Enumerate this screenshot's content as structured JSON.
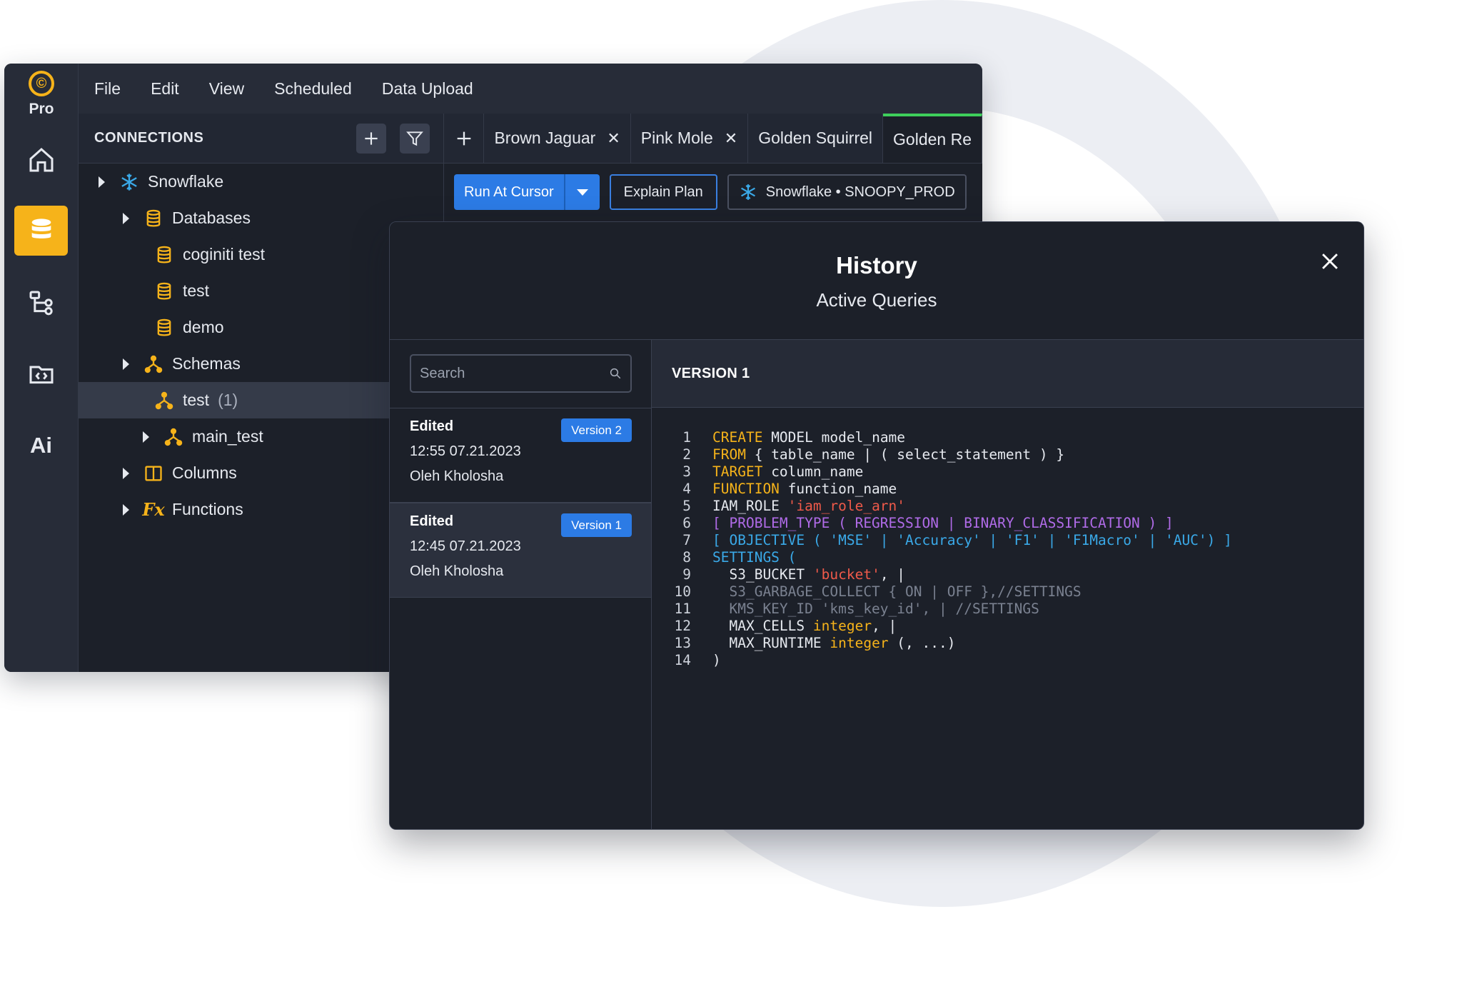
{
  "app": {
    "logo_text": "Pro",
    "rail": {
      "ai_label": "Ai"
    },
    "menu": [
      "File",
      "Edit",
      "View",
      "Scheduled",
      "Data Upload"
    ],
    "connections": {
      "title": "CONNECTIONS",
      "tree": [
        {
          "label": "Snowflake"
        },
        {
          "label": "Databases"
        },
        {
          "label": "coginiti test"
        },
        {
          "label": "test"
        },
        {
          "label": "demo"
        },
        {
          "label": "Schemas"
        },
        {
          "label": "test",
          "count": "(1)"
        },
        {
          "label": "main_test"
        },
        {
          "label": "Columns"
        },
        {
          "label": "Functions",
          "icon_text": "Fx"
        }
      ]
    },
    "tabs": [
      {
        "label": "Brown Jaguar",
        "close": "✕"
      },
      {
        "label": "Pink Mole",
        "close": "✕"
      },
      {
        "label": "Golden Squirrel"
      },
      {
        "label": "Golden Re"
      }
    ],
    "toolbar": {
      "run": "Run At Cursor",
      "explain": "Explain Plan",
      "connection": "Snowflake • SNOOPY_PROD"
    }
  },
  "history": {
    "title": "History",
    "subtitle": "Active Queries",
    "search_placeholder": "Search",
    "entries": [
      {
        "status": "Edited",
        "time": "12:55 07.21.2023",
        "user": "Oleh Kholosha",
        "version": "Version 2"
      },
      {
        "status": "Edited",
        "time": "12:45 07.21.2023",
        "user": "Oleh Kholosha",
        "version": "Version 1"
      }
    ],
    "version_header": "VERSION 1",
    "code": [
      {
        "n": "1",
        "segs": [
          [
            "kw",
            "CREATE"
          ],
          [
            "pl",
            " MODEL model_name"
          ]
        ]
      },
      {
        "n": "2",
        "segs": [
          [
            "kw",
            "FROM"
          ],
          [
            "pl",
            " { table_name | ( select_statement ) }"
          ]
        ]
      },
      {
        "n": "3",
        "segs": [
          [
            "kw",
            "TARGET"
          ],
          [
            "pl",
            " column_name"
          ]
        ]
      },
      {
        "n": "4",
        "segs": [
          [
            "kw",
            "FUNCTION"
          ],
          [
            "pl",
            " function_name"
          ]
        ]
      },
      {
        "n": "5",
        "segs": [
          [
            "pl",
            "IAM_ROLE "
          ],
          [
            "str",
            "'iam_role_arn'"
          ]
        ]
      },
      {
        "n": "6",
        "segs": [
          [
            "pu",
            "[ PROBLEM_TYPE ( REGRESSION | BINARY_CLASSIFICATION ) ]"
          ]
        ]
      },
      {
        "n": "7",
        "segs": [
          [
            "bl",
            "[ OBJECTIVE ( 'MSE' | 'Accuracy' | 'F1' | 'F1Macro' | 'AUC') ]"
          ]
        ]
      },
      {
        "n": "8",
        "segs": [
          [
            "bl",
            "SETTINGS ("
          ]
        ]
      },
      {
        "n": "9",
        "segs": [
          [
            "pl",
            "  S3_BUCKET "
          ],
          [
            "str",
            "'bucket'"
          ],
          [
            "pl",
            ", |"
          ]
        ]
      },
      {
        "n": "10",
        "segs": [
          [
            "dim",
            "  S3_GARBAGE_COLLECT { ON | OFF },//SETTINGS"
          ]
        ]
      },
      {
        "n": "11",
        "segs": [
          [
            "dim",
            "  KMS_KEY_ID 'kms_key_id', | //SETTINGS"
          ]
        ]
      },
      {
        "n": "12",
        "segs": [
          [
            "pl",
            "  MAX_CELLS "
          ],
          [
            "kw",
            "integer"
          ],
          [
            "pl",
            ", |"
          ]
        ]
      },
      {
        "n": "13",
        "segs": [
          [
            "pl",
            "  MAX_RUNTIME "
          ],
          [
            "kw",
            "integer"
          ],
          [
            "pl",
            " (, ...)"
          ]
        ]
      },
      {
        "n": "14",
        "segs": [
          [
            "pl",
            ")"
          ]
        ]
      }
    ]
  }
}
